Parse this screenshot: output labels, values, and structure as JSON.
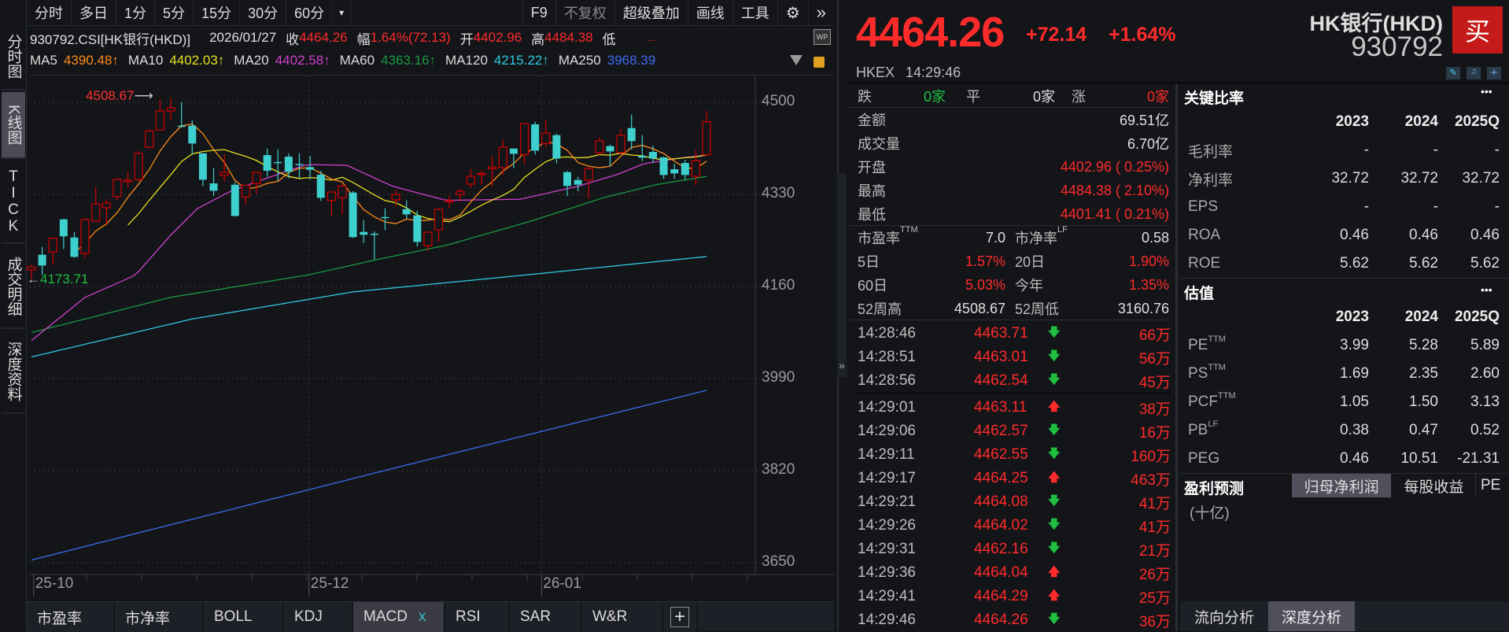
{
  "sidebar": [
    {
      "label": "分时图"
    },
    {
      "label": "K线图"
    },
    {
      "label": "TICK"
    },
    {
      "label": "成交明细"
    },
    {
      "label": "深度资料"
    }
  ],
  "toolbar": {
    "periods": [
      "分时",
      "多日",
      "1分",
      "5分",
      "15分",
      "30分",
      "60分"
    ],
    "more": "▾",
    "tools": [
      "F9",
      "不复权",
      "超级叠加",
      "画线",
      "工具"
    ],
    "gear": "⚙",
    "expand": "»"
  },
  "info": {
    "code": "930792.CSI[HK银行(HKD)]",
    "date": "2026/01/27",
    "close_label": "收",
    "close": "4464.26",
    "range_label": "幅",
    "range": "1.64%(72.13)",
    "open_label": "开",
    "open": "4402.96",
    "high_label": "高",
    "high": "4484.38",
    "low_label": "低",
    "low": "...",
    "wp": "WP"
  },
  "ma": [
    {
      "name": "MA5",
      "value": "4390.48↑",
      "color": "#ff8c1a"
    },
    {
      "name": "MA10",
      "value": "4402.03↑",
      "color": "#e8e020"
    },
    {
      "name": "MA20",
      "value": "4402.58↑",
      "color": "#d040d0"
    },
    {
      "name": "MA60",
      "value": "4363.16↑",
      "color": "#1a9a40"
    },
    {
      "name": "MA120",
      "value": "4215.22↑",
      "color": "#30c8e0"
    },
    {
      "name": "MA250",
      "value": "3968.39",
      "color": "#3c6cf0"
    }
  ],
  "chart_data": {
    "type": "candlestick",
    "y_ticks": [
      4500,
      4330,
      4160,
      3990,
      3820,
      3650
    ],
    "ylim": [
      3650,
      4500
    ],
    "x_ticks": [
      {
        "label": "25-10",
        "index": 0.2
      },
      {
        "label": "25-12",
        "index": 25.9
      },
      {
        "label": "26-01",
        "index": 47.6
      }
    ],
    "high_marker": {
      "label": "4508.67",
      "index": 13
    },
    "low_marker": {
      "label": "4173.71",
      "index": 0
    },
    "candles": [
      [
        4190.5,
        4200.2,
        4173.71,
        4196.3
      ],
      [
        4218.6,
        4233.1,
        4180.8,
        4198.7
      ],
      [
        4223.9,
        4251,
        4200.2,
        4249.1
      ],
      [
        4284,
        4285,
        4229.2,
        4252.5
      ],
      [
        4250.5,
        4260.7,
        4213,
        4214.7
      ],
      [
        4221,
        4286.4,
        4213,
        4283.5
      ],
      [
        4280.6,
        4343.5,
        4280,
        4312.5
      ],
      [
        4305.3,
        4321.3,
        4275.3,
        4314
      ],
      [
        4326.1,
        4360,
        4318.8,
        4357.6
      ],
      [
        4353.7,
        4372.1,
        4343,
        4356.6
      ],
      [
        4357.6,
        4410.8,
        4354.2,
        4405.5
      ],
      [
        4417.1,
        4449.6,
        4415.2,
        4447.2
      ],
      [
        4449.1,
        4505.3,
        4449,
        4484
      ],
      [
        4484,
        4508.67,
        4467.5,
        4489.8
      ],
      [
        4456.9,
        4500.4,
        4453,
        4456
      ],
      [
        4456.9,
        4466.5,
        4403.6,
        4423.9
      ],
      [
        4406,
        4406.5,
        4345.5,
        4357.1
      ],
      [
        4350.3,
        4378.4,
        4327.1,
        4336.7
      ],
      [
        4364.8,
        4404.6,
        4352.7,
        4370.6
      ],
      [
        4347.9,
        4352.7,
        4288.8,
        4290.2
      ],
      [
        4325.1,
        4347,
        4310.6,
        4346.9
      ],
      [
        4350.3,
        4371,
        4331,
        4370.6
      ],
      [
        4402.6,
        4414.7,
        4362.4,
        4373.6
      ],
      [
        4389.8,
        4413.3,
        4355.2,
        4389.5
      ],
      [
        4399.7,
        4406,
        4360,
        4371.6
      ],
      [
        4386.3,
        4406,
        4360,
        4386
      ],
      [
        4380.3,
        4401.2,
        4357.6,
        4375.5
      ],
      [
        4366.3,
        4373.6,
        4317.9,
        4323.7
      ],
      [
        4318.8,
        4335.8,
        4289.8,
        4334.3
      ],
      [
        4323.7,
        4347.9,
        4293.2,
        4345.5
      ],
      [
        4333.4,
        4335.8,
        4249.6,
        4251
      ],
      [
        4260.7,
        4282.5,
        4240.4,
        4255.4
      ],
      [
        4257.4,
        4262.2,
        4209.9,
        4257.2
      ],
      [
        4288.3,
        4304.3,
        4264.1,
        4286.4
      ],
      [
        4319.8,
        4338.2,
        4307.7,
        4330
      ],
      [
        4302.8,
        4318.8,
        4285,
        4293.2
      ],
      [
        4291.2,
        4299.5,
        4234.1,
        4242.3
      ],
      [
        4235.5,
        4260.5,
        4225.8,
        4260.2
      ],
      [
        4264.6,
        4305.8,
        4242.3,
        4302.4
      ],
      [
        4317.4,
        4327.1,
        4304.3,
        4318.4
      ],
      [
        4330,
        4340.6,
        4316.4,
        4335.8
      ],
      [
        4348.9,
        4377,
        4342.1,
        4363.4
      ],
      [
        4368.1,
        4374.5,
        4347.9,
        4368.7
      ],
      [
        4377.4,
        4401.7,
        4345.5,
        4380.8
      ],
      [
        4379.4,
        4431.7,
        4365.8,
        4417.1
      ],
      [
        4414.7,
        4415,
        4378.4,
        4405
      ],
      [
        4403.6,
        4461,
        4386.1,
        4460.7
      ],
      [
        4459.3,
        4464.1,
        4403.6,
        4410.8
      ],
      [
        4423.9,
        4468.5,
        4417.1,
        4443.3
      ],
      [
        4439.4,
        4442.3,
        4387.6,
        4396.3
      ],
      [
        4371.1,
        4373.6,
        4327.1,
        4345.5
      ],
      [
        4356.6,
        4362.4,
        4335.8,
        4347.9
      ],
      [
        4356.1,
        4380.3,
        4322.2,
        4377.9
      ],
      [
        4407,
        4435.1,
        4402.6,
        4428.8
      ],
      [
        4419.1,
        4422,
        4381.8,
        4409.4
      ],
      [
        4407,
        4451,
        4404.6,
        4438.9
      ],
      [
        4452.5,
        4477.2,
        4413.3,
        4428.3
      ],
      [
        4401.2,
        4439.4,
        4391.5,
        4397.8
      ],
      [
        4408.4,
        4420,
        4387.6,
        4396.3
      ],
      [
        4398.3,
        4399.7,
        4358.5,
        4365.8
      ],
      [
        4376.5,
        4386.6,
        4358.5,
        4368.7
      ],
      [
        4388.1,
        4393.9,
        4357.6,
        4365.8
      ],
      [
        4363.4,
        4411.8,
        4346.9,
        4392
      ],
      [
        4402.96,
        4484.38,
        4401.41,
        4464.26
      ]
    ],
    "ma_keypoints": {
      "MA20": [
        [
          0,
          4060
        ],
        [
          5,
          4140
        ],
        [
          9.7,
          4181
        ],
        [
          13,
          4255
        ],
        [
          15.5,
          4304
        ],
        [
          18.6,
          4336
        ],
        [
          23.4,
          4370
        ],
        [
          25.7,
          4385
        ],
        [
          29.4,
          4384
        ],
        [
          33.7,
          4345
        ],
        [
          38.7,
          4319
        ],
        [
          45.6,
          4321
        ],
        [
          51,
          4345
        ],
        [
          54.7,
          4367
        ],
        [
          57.2,
          4387
        ],
        [
          60.9,
          4398
        ],
        [
          63,
          4402.58
        ]
      ],
      "MA60": [
        [
          0,
          4075
        ],
        [
          13,
          4140
        ],
        [
          26,
          4182
        ],
        [
          32.3,
          4210
        ],
        [
          38.7,
          4236
        ],
        [
          46.5,
          4280
        ],
        [
          53.4,
          4324
        ],
        [
          58.3,
          4348
        ],
        [
          63,
          4363.16
        ]
      ],
      "MA120": [
        [
          0,
          4030
        ],
        [
          15,
          4100
        ],
        [
          30,
          4150
        ],
        [
          46.5,
          4182
        ],
        [
          63,
          4215.22
        ]
      ],
      "MA250": [
        [
          0,
          3655
        ],
        [
          32.5,
          3818
        ],
        [
          63,
          3968.39
        ]
      ]
    }
  },
  "bottom_tabs": [
    {
      "label": "市盈率"
    },
    {
      "label": "市净率"
    },
    {
      "label": "BOLL"
    },
    {
      "label": "KDJ"
    },
    {
      "label": "MACD",
      "close": "x"
    },
    {
      "label": "RSI"
    },
    {
      "label": "SAR"
    },
    {
      "label": "W&R"
    },
    {
      "label": "+"
    }
  ],
  "quote": {
    "price": "4464.26",
    "change": "+72.14",
    "pct": "+1.64%",
    "name": "HK银行(HKD)",
    "code": "930792",
    "buy": "买",
    "exchange": "HKEX",
    "time": "14:29:46"
  },
  "breadth": {
    "down_label": "跌",
    "down": "0家",
    "flat_label": "平",
    "flat": "0家",
    "up_label": "涨",
    "up": "0家"
  },
  "stats": [
    {
      "label": "金额",
      "value": "69.51亿",
      "color": "#e0e0e0"
    },
    {
      "label": "成交量",
      "value": "6.70亿",
      "color": "#e0e0e0"
    },
    {
      "label": "开盘",
      "value": "4402.96 ( 0.25%)",
      "color": "#ff2b2b"
    },
    {
      "label": "最高",
      "value": "4484.38 ( 2.10%)",
      "color": "#ff2b2b"
    },
    {
      "label": "最低",
      "value": "4401.41 ( 0.21%)",
      "color": "#ff2b2b"
    }
  ],
  "stats2": [
    {
      "l1": "市盈率",
      "s1": "TTM",
      "v1": "7.0",
      "c1": "#e0e0e0",
      "l2": "市净率",
      "s2": "LF",
      "v2": "0.58",
      "c2": "#e0e0e0"
    },
    {
      "l1": "5日",
      "s1": "",
      "v1": "1.57%",
      "c1": "#ff2b2b",
      "l2": "20日",
      "s2": "",
      "v2": "1.90%",
      "c2": "#ff2b2b"
    },
    {
      "l1": "60日",
      "s1": "",
      "v1": "5.03%",
      "c1": "#ff2b2b",
      "l2": "今年",
      "s2": "",
      "v2": "1.35%",
      "c2": "#ff2b2b"
    },
    {
      "l1": "52周高",
      "s1": "",
      "v1": "4508.67",
      "c1": "#e0e0e0",
      "l2": "52周低",
      "s2": "",
      "v2": "3160.76",
      "c2": "#e0e0e0"
    }
  ],
  "trades": [
    {
      "time": "14:28:46",
      "price": "4463.71",
      "dir": "down",
      "vol": "66万"
    },
    {
      "time": "14:28:51",
      "price": "4463.01",
      "dir": "down",
      "vol": "56万"
    },
    {
      "time": "14:28:56",
      "price": "4462.54",
      "dir": "down",
      "vol": "45万"
    },
    {
      "time": "14:29:01",
      "price": "4463.11",
      "dir": "up",
      "vol": "38万"
    },
    {
      "time": "14:29:06",
      "price": "4462.57",
      "dir": "down",
      "vol": "16万"
    },
    {
      "time": "14:29:11",
      "price": "4462.55",
      "dir": "down",
      "vol": "160万"
    },
    {
      "time": "14:29:17",
      "price": "4464.25",
      "dir": "up",
      "vol": "463万"
    },
    {
      "time": "14:29:21",
      "price": "4464.08",
      "dir": "down",
      "vol": "41万"
    },
    {
      "time": "14:29:26",
      "price": "4464.02",
      "dir": "down",
      "vol": "41万"
    },
    {
      "time": "14:29:31",
      "price": "4462.16",
      "dir": "down",
      "vol": "21万"
    },
    {
      "time": "14:29:36",
      "price": "4464.04",
      "dir": "up",
      "vol": "26万"
    },
    {
      "time": "14:29:41",
      "price": "4464.29",
      "dir": "up",
      "vol": "25万"
    },
    {
      "time": "14:29:46",
      "price": "4464.26",
      "dir": "down",
      "vol": "36万"
    }
  ],
  "key_ratios": {
    "title": "关键比率",
    "more": "•••",
    "years": [
      "2023",
      "2024",
      "2025Q"
    ],
    "rows": [
      {
        "label": "毛利率",
        "sup": "",
        "values": [
          "-",
          "-",
          "-"
        ]
      },
      {
        "label": "净利率",
        "sup": "",
        "values": [
          "32.72",
          "32.72",
          "32.72"
        ]
      },
      {
        "label": "EPS",
        "sup": "",
        "values": [
          "-",
          "-",
          "-"
        ]
      },
      {
        "label": "ROA",
        "sup": "",
        "values": [
          "0.46",
          "0.46",
          "0.46"
        ]
      },
      {
        "label": "ROE",
        "sup": "",
        "values": [
          "5.62",
          "5.62",
          "5.62"
        ]
      }
    ]
  },
  "valuation": {
    "title": "估值",
    "more": "•••",
    "years": [
      "2023",
      "2024",
      "2025Q"
    ],
    "rows": [
      {
        "label": "PE",
        "sup": "TTM",
        "values": [
          "3.99",
          "5.28",
          "5.89"
        ]
      },
      {
        "label": "PS",
        "sup": "TTM",
        "values": [
          "1.69",
          "2.35",
          "2.60"
        ]
      },
      {
        "label": "PCF",
        "sup": "TTM",
        "values": [
          "1.05",
          "1.50",
          "3.13"
        ]
      },
      {
        "label": "PB",
        "sup": "LF",
        "values": [
          "0.38",
          "0.47",
          "0.52"
        ]
      },
      {
        "label": "PEG",
        "sup": "",
        "values": [
          "0.46",
          "10.51",
          "-21.31"
        ]
      }
    ]
  },
  "forecast": {
    "title": "盈利预测",
    "tabs": [
      "归母净利润",
      "每股收益",
      "PE"
    ],
    "unit": "(十亿)"
  },
  "analysis_tabs": [
    "流向分析",
    "深度分析"
  ],
  "collapse": "»",
  "colors": {
    "up": "#ff2b2b",
    "down": "#1fbf3f",
    "candle_up": "#d40000",
    "candle_down": "#3ecfcf",
    "bg": "#131519"
  }
}
